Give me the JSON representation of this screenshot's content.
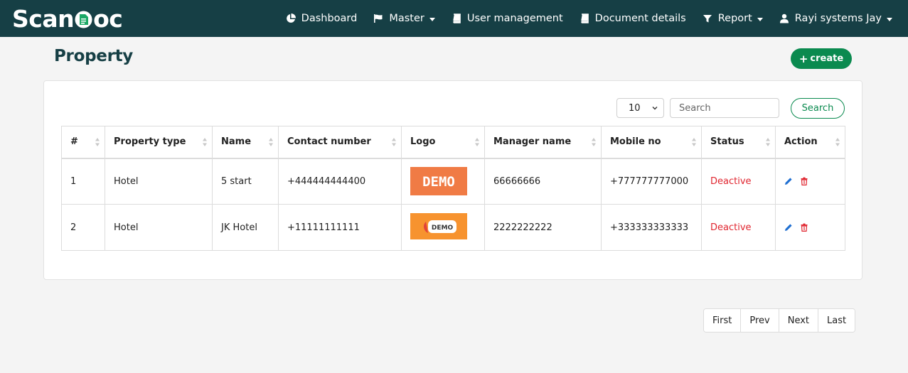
{
  "brand": {
    "prefix": "Scan",
    "suffix": "oc",
    "accent": "#1ca866"
  },
  "nav": {
    "items": [
      {
        "label": "Dashboard",
        "icon": "pie-chart-icon",
        "dropdown": false
      },
      {
        "label": "Master",
        "icon": "flag-icon",
        "dropdown": true
      },
      {
        "label": "User management",
        "icon": "book-icon",
        "dropdown": false
      },
      {
        "label": "Document details",
        "icon": "book-icon",
        "dropdown": false
      },
      {
        "label": "Report",
        "icon": "filter-icon",
        "dropdown": true
      },
      {
        "label": "Rayi systems Jay",
        "icon": "user-icon",
        "dropdown": true
      }
    ]
  },
  "page": {
    "title": "Property",
    "create_label": "create"
  },
  "toolbar": {
    "page_size": "10",
    "search_placeholder": "Search",
    "search_label": "Search"
  },
  "table": {
    "columns": [
      "#",
      "Property type",
      "Name",
      "Contact number",
      "Logo",
      "Manager name",
      "Mobile no",
      "Status",
      "Action"
    ],
    "rows": [
      {
        "index": "1",
        "property_type": "Hotel",
        "name": "5 start",
        "contact": "+444444444400",
        "logo": "DEMO",
        "manager": "66666666",
        "mobile": "+777777777000",
        "status": "Deactive"
      },
      {
        "index": "2",
        "property_type": "Hotel",
        "name": "JK Hotel",
        "contact": "+11111111111",
        "logo": "DEMO",
        "manager": "2222222222",
        "mobile": "+333333333333",
        "status": "Deactive"
      }
    ]
  },
  "pagination": {
    "first": "First",
    "prev": "Prev",
    "next": "Next",
    "last": "Last"
  },
  "colors": {
    "navbar": "#163f45",
    "primary": "#0a8a4f",
    "danger": "#e0252f",
    "edit": "#1f6fd1"
  }
}
